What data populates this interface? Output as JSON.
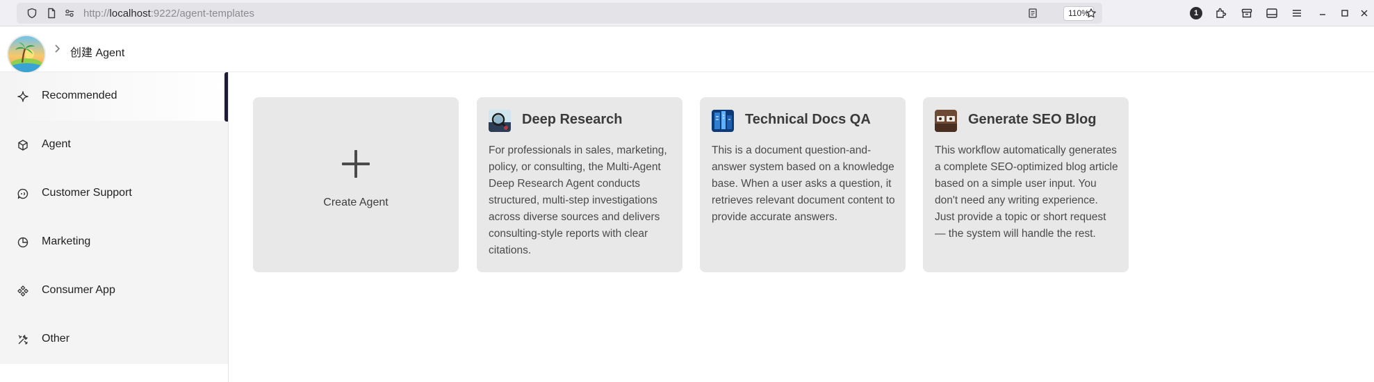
{
  "browser": {
    "url_prefix": "http://",
    "url_host": "localhost",
    "url_rest": ":9222/agent-templates",
    "zoom": "110%",
    "notification_count": "1"
  },
  "header": {
    "breadcrumb": "创建 Agent"
  },
  "sidebar": {
    "items": [
      {
        "label": "Recommended",
        "icon": "sparkle-icon",
        "active": true
      },
      {
        "label": "Agent",
        "icon": "cube-icon",
        "active": false
      },
      {
        "label": "Customer Support",
        "icon": "chat-bubble-icon",
        "active": false
      },
      {
        "label": "Marketing",
        "icon": "pie-chart-icon",
        "active": false
      },
      {
        "label": "Consumer App",
        "icon": "component-icon",
        "active": false
      },
      {
        "label": "Other",
        "icon": "tools-icon",
        "active": false
      }
    ]
  },
  "cards": {
    "create": {
      "label": "Create Agent"
    },
    "templates": [
      {
        "title": "Deep Research",
        "description": "For professionals in sales, marketing, policy, or consulting, the Multi-Agent Deep Research Agent conducts structured, multi-step investigations across diverse sources and delivers consulting-style reports with clear citations."
      },
      {
        "title": "Technical Docs QA",
        "description": "This is a document question-and-answer system based on a knowledge base. When a user asks a question, it retrieves relevant document content to provide accurate answers."
      },
      {
        "title": "Generate SEO Blog",
        "description": "This workflow automatically generates a complete SEO-optimized blog article based on a simple user input. You don't need any writing experience. Just provide a topic or short request — the system will handle the rest."
      }
    ]
  },
  "colors": {
    "sidebar_bg": "#f4f4f4",
    "card_bg": "#e8e8e8",
    "active_indicator": "#1c1c3a"
  }
}
